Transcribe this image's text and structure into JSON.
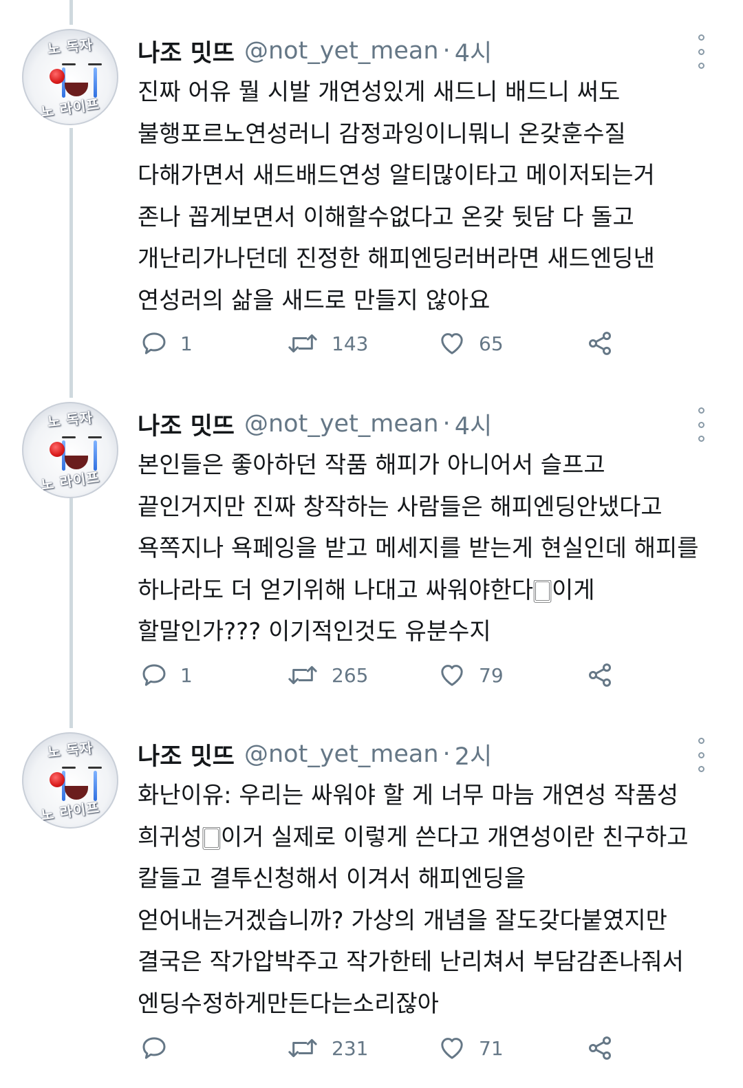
{
  "tweets": [
    {
      "author": {
        "display_name": "나조 밋뜨",
        "handle": "@not_yet_mean",
        "avatar_top_text": "노 독자",
        "avatar_bottom_text": "노 라이프"
      },
      "separator": "·",
      "time": "4시",
      "lines": [
        "진짜 어유 뭘 시발 개연성있게 새드니 배드니 써도",
        "불행포르노연성러니 감정과잉이니뭐니 온갖훈수질",
        "다해가면서 새드배드연성 알티많이타고 메이저되는거",
        "존나 꼽게보면서 이해할수없다고 온갖 뒷담 다 돌고",
        "개난리가나던데 진정한 해피엔딩러버라면 새드엔딩낸",
        "연성러의 삶을 새드로 만들지 않아요"
      ],
      "replies": "1",
      "retweets": "143",
      "likes": "65"
    },
    {
      "author": {
        "display_name": "나조 밋뜨",
        "handle": "@not_yet_mean",
        "avatar_top_text": "노 독자",
        "avatar_bottom_text": "노 라이프"
      },
      "separator": "·",
      "time": "4시",
      "lines": [
        "본인들은 좋아하던 작품 해피가 아니어서 슬프고",
        "끝인거지만 진짜 창작하는 사람들은 해피엔딩안냈다고",
        "욕쪽지나 욕페잉을 받고 메세지를 받는게 현실인데 해피를",
        "하나라도 더 얻기위해 나대고 싸워야한다🀆이게",
        "할말인가??? 이기적인것도 유분수지"
      ],
      "replies": "1",
      "retweets": "265",
      "likes": "79"
    },
    {
      "author": {
        "display_name": "나조 밋뜨",
        "handle": "@not_yet_mean",
        "avatar_top_text": "노 독자",
        "avatar_bottom_text": "노 라이프"
      },
      "separator": "·",
      "time": "2시",
      "lines": [
        "화난이유: 우리는 싸워야 할 게 너무 마늠 개연성 작품성",
        "희귀성🀆이거 실제로 이렇게 쓴다고 개연성이란 친구하고",
        "칼들고 결투신청해서 이겨서 해피엔딩을",
        "얻어내는거겠습니까? 가상의 개념을 잘도갖다붙였지만",
        "결국은 작가압박주고 작가한테 난리쳐서 부담감존나줘서",
        "엔딩수정하게만든다는소리잖아"
      ],
      "replies": "",
      "retweets": "231",
      "likes": "71"
    }
  ],
  "icons": {
    "reply": "reply-icon",
    "retweet": "retweet-icon",
    "like": "heart-icon",
    "share": "share-icon",
    "more": "more-icon"
  },
  "colors": {
    "text": "#14171a",
    "secondary": "#657786",
    "icon": "#657786",
    "thread_line": "#cfd9de",
    "background": "#ffffff"
  }
}
